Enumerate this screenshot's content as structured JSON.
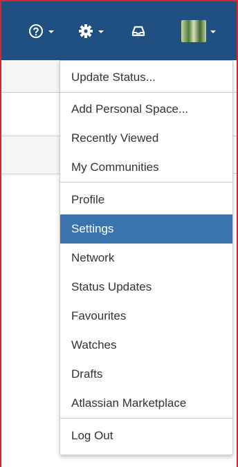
{
  "header": {
    "help_icon": "help-icon",
    "settings_icon": "gear-icon",
    "notifications_icon": "inbox-icon",
    "profile_icon": "avatar-image",
    "bg_color": "#205081"
  },
  "menu": {
    "groups": [
      {
        "items": [
          "Update Status..."
        ]
      },
      {
        "items": [
          "Add Personal Space...",
          "Recently Viewed",
          "My Communities"
        ]
      },
      {
        "items": [
          "Profile",
          "Settings",
          "Network",
          "Status Updates",
          "Favourites",
          "Watches",
          "Drafts",
          "Atlassian Marketplace"
        ]
      },
      {
        "items": [
          "Log Out"
        ]
      }
    ],
    "active_item": "Settings",
    "active_color": "#3b73af"
  }
}
